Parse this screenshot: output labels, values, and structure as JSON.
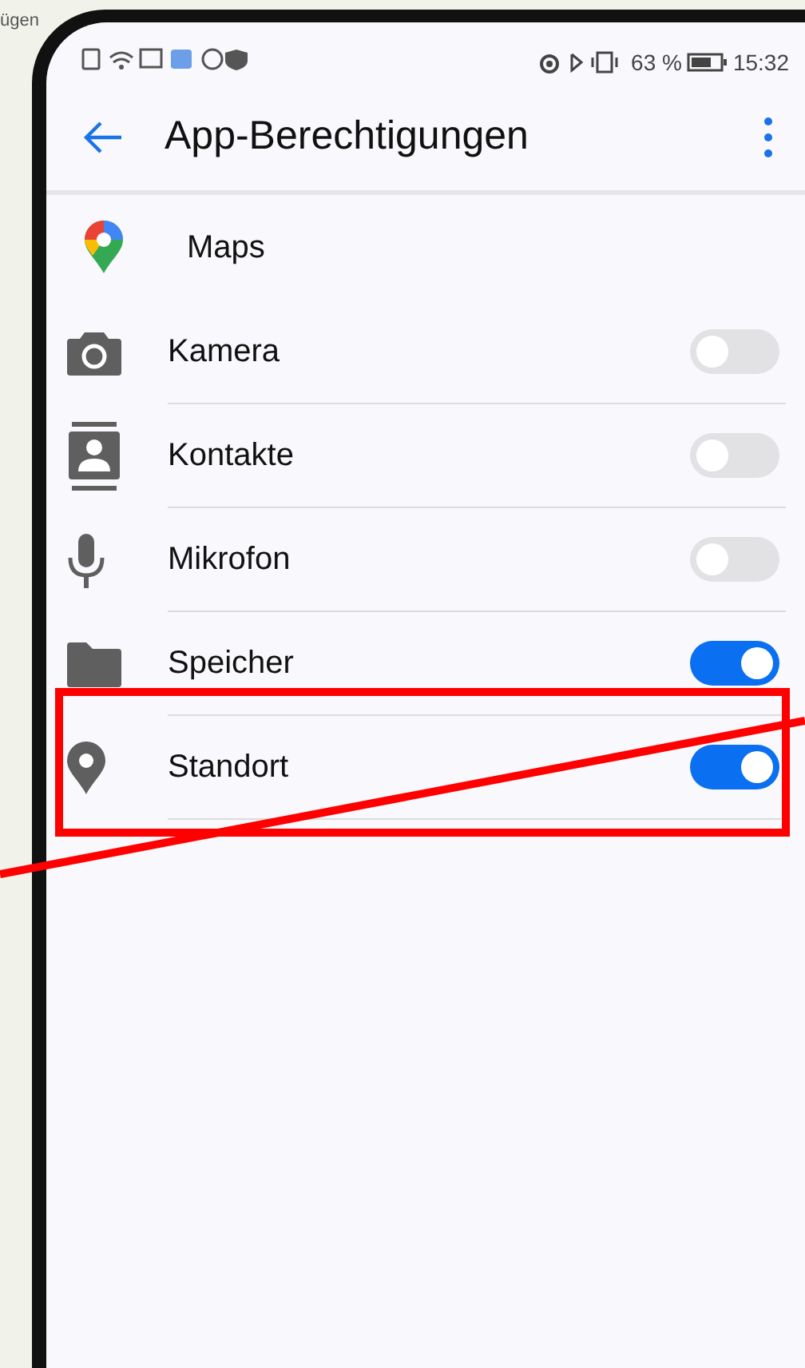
{
  "background_fragment": "ügen",
  "status_bar": {
    "battery": "63 %",
    "time": "15:32"
  },
  "header": {
    "title": "App-Berechtigungen"
  },
  "app": {
    "name": "Maps"
  },
  "permissions": [
    {
      "kind": "camera",
      "label": "Kamera",
      "on": false
    },
    {
      "kind": "contacts",
      "label": "Kontakte",
      "on": false
    },
    {
      "kind": "microphone",
      "label": "Mikrofon",
      "on": false
    },
    {
      "kind": "storage",
      "label": "Speicher",
      "on": true
    },
    {
      "kind": "location",
      "label": "Standort",
      "on": true
    }
  ]
}
